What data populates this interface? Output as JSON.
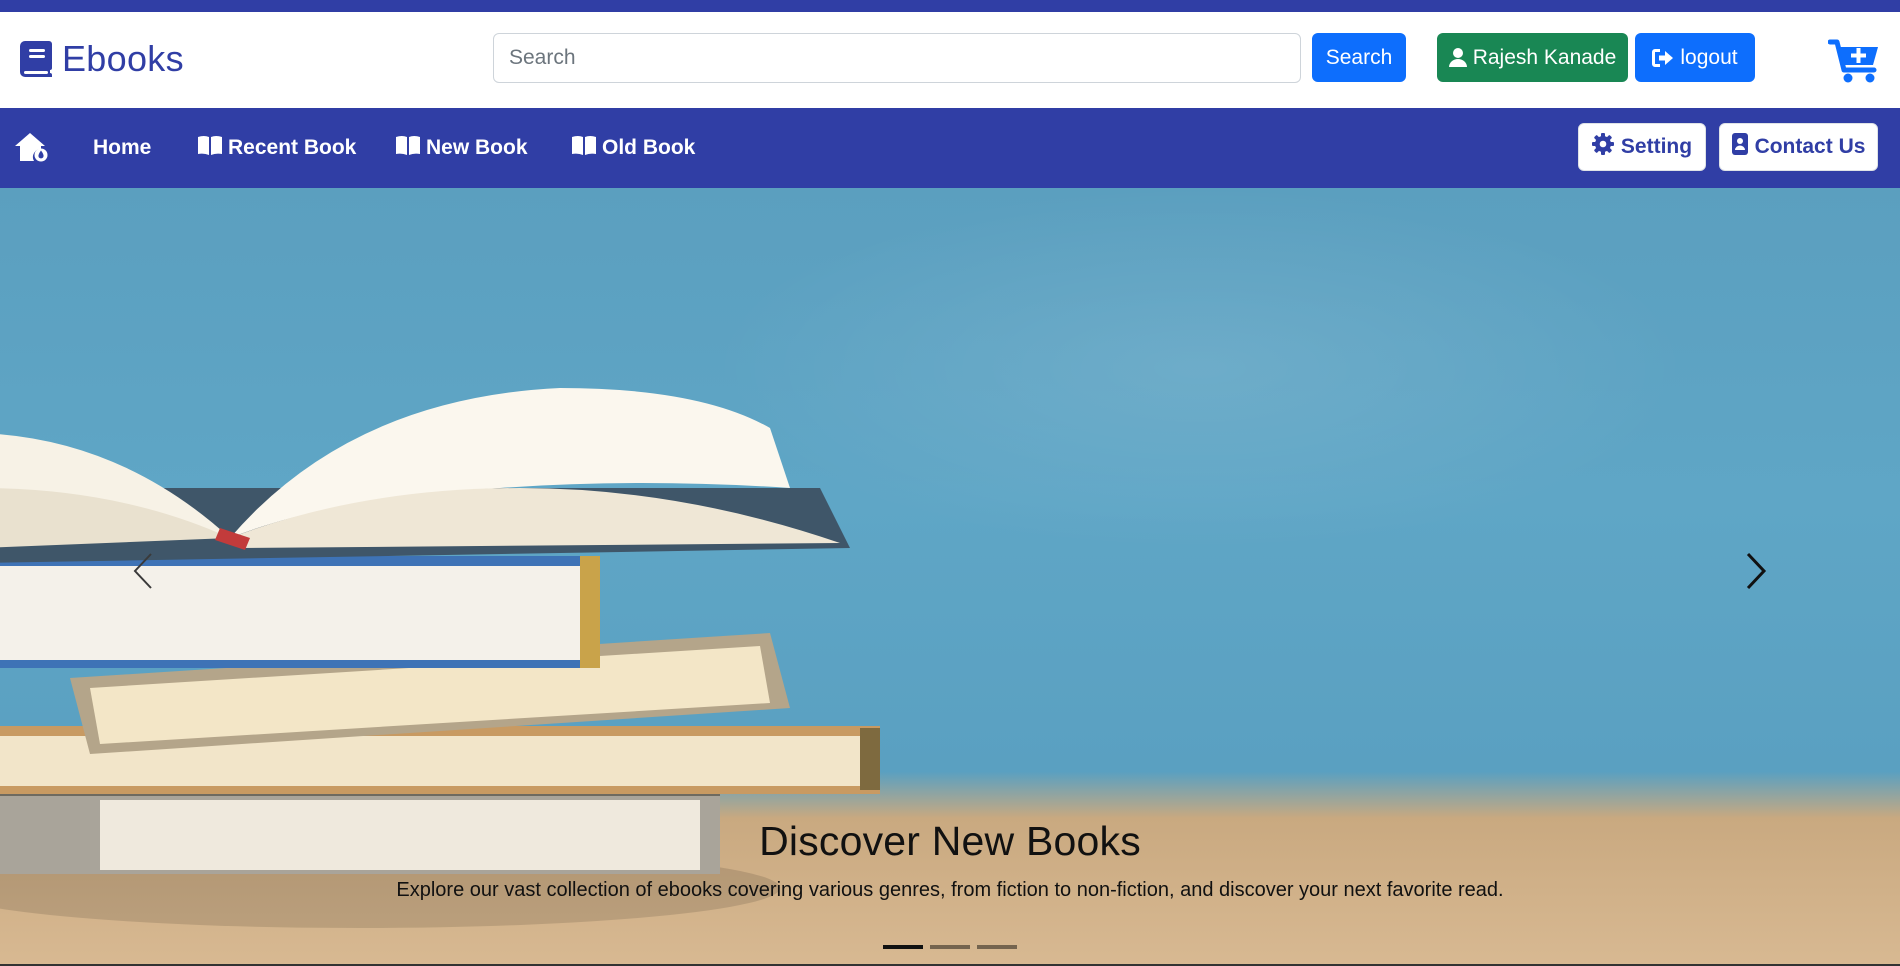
{
  "brand": {
    "name": "Ebooks",
    "icon": "book-icon"
  },
  "search": {
    "placeholder": "Search",
    "value": "",
    "button_label": "Search"
  },
  "user": {
    "name": "Rajesh Kanade",
    "icon": "user-icon"
  },
  "logout": {
    "label": "logout",
    "icon": "sign-out-icon"
  },
  "cart": {
    "icon": "cart-plus-icon"
  },
  "nav": {
    "home_icon": "home-icon",
    "items": [
      {
        "label": "Home"
      },
      {
        "label": "Recent Book",
        "icon": "book-open-icon"
      },
      {
        "label": "New Book",
        "icon": "book-open-icon"
      },
      {
        "label": "Old Book",
        "icon": "book-open-icon"
      }
    ],
    "setting_label": "Setting",
    "contact_label": "Contact Us"
  },
  "carousel": {
    "title": "Discover New Books",
    "text": "Explore our vast collection of ebooks covering various genres, from fiction to non-fiction, and discover your next favorite read.",
    "slide_count": 3,
    "active_slide": 1
  },
  "colors": {
    "brand": "#303ea5",
    "primary": "#0d6efd",
    "success": "#198754"
  }
}
